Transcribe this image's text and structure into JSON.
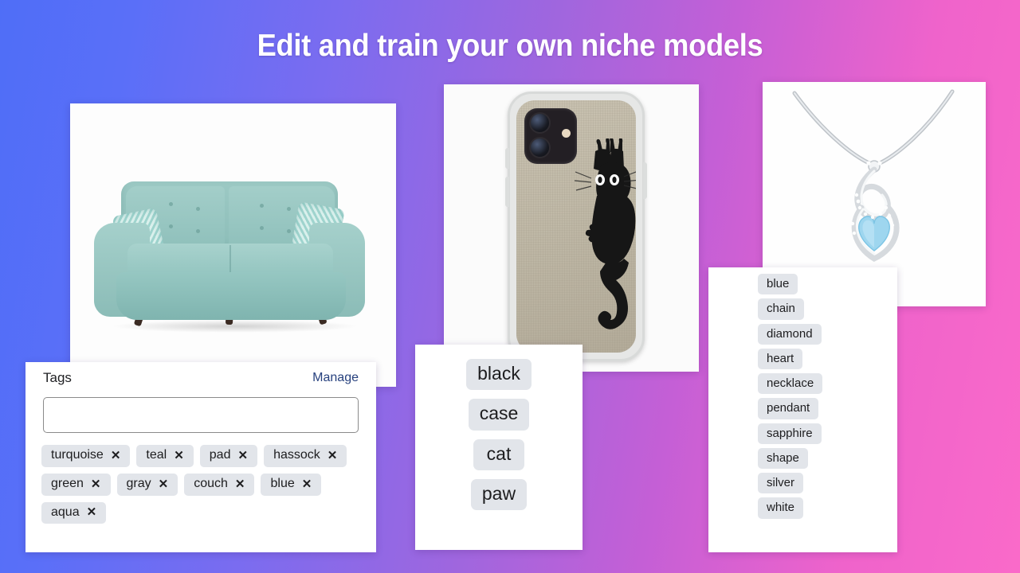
{
  "headline": "Edit and train your own niche models",
  "colors": {
    "gradient_start": "#4f6ef7",
    "gradient_mid": "#a066de",
    "gradient_end": "#fa6ac9",
    "chip_bg": "#e2e5ea",
    "link": "#27417e",
    "card_bg": "#ffffff"
  },
  "sofa_card": {
    "alt": "teal mid-century sofa product photo"
  },
  "tags_panel": {
    "title": "Tags",
    "manage_label": "Manage",
    "input_value": "",
    "input_placeholder": "",
    "remove_glyph": "✕",
    "tags": [
      "turquoise",
      "teal",
      "pad",
      "hassock",
      "green",
      "gray",
      "couch",
      "blue",
      "aqua"
    ]
  },
  "phone_card": {
    "alt": "iPhone case with black cat climbing design"
  },
  "mid_tags_panel": {
    "tags": [
      "black",
      "case",
      "cat",
      "paw"
    ]
  },
  "necklace_card": {
    "alt": "silver infinity pendant necklace with blue heart gemstone"
  },
  "right_tags_panel": {
    "tags": [
      "blue",
      "chain",
      "diamond",
      "heart",
      "necklace",
      "pendant",
      "sapphire",
      "shape",
      "silver",
      "white"
    ]
  }
}
